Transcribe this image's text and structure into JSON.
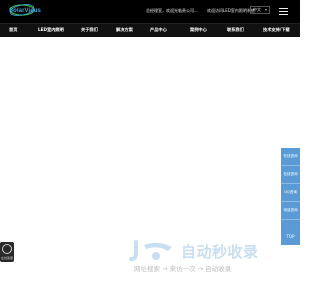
{
  "header": {
    "logo_text": "SolarVieus",
    "notices": [
      "总经理室，欢迎光临贵公司...",
      "欢迎访问LED室内照明系统"
    ],
    "language": "中文"
  },
  "nav": {
    "items": [
      "首页",
      "LED室内照明",
      "关于我们",
      "解决方案",
      "产品中心",
      "案例中心",
      "联系我们",
      "技术支持/下载"
    ]
  },
  "sidebar": {
    "items": [
      "在线咨询",
      "在线咨询",
      "QQ咨询",
      "电话咨询"
    ],
    "top_label": "TOP"
  },
  "chat": {
    "caption": "在线客服"
  },
  "watermark": {
    "title": "自动秒收录",
    "caption": "网址搜索 → 来访一次 → 自动收录"
  },
  "colors": {
    "header_bg": "#000000",
    "nav_bg": "#111111",
    "sidebar_bg": "#5b9bd5",
    "brand": "#39a9e0",
    "watermark_accent": "#c8dff2"
  }
}
